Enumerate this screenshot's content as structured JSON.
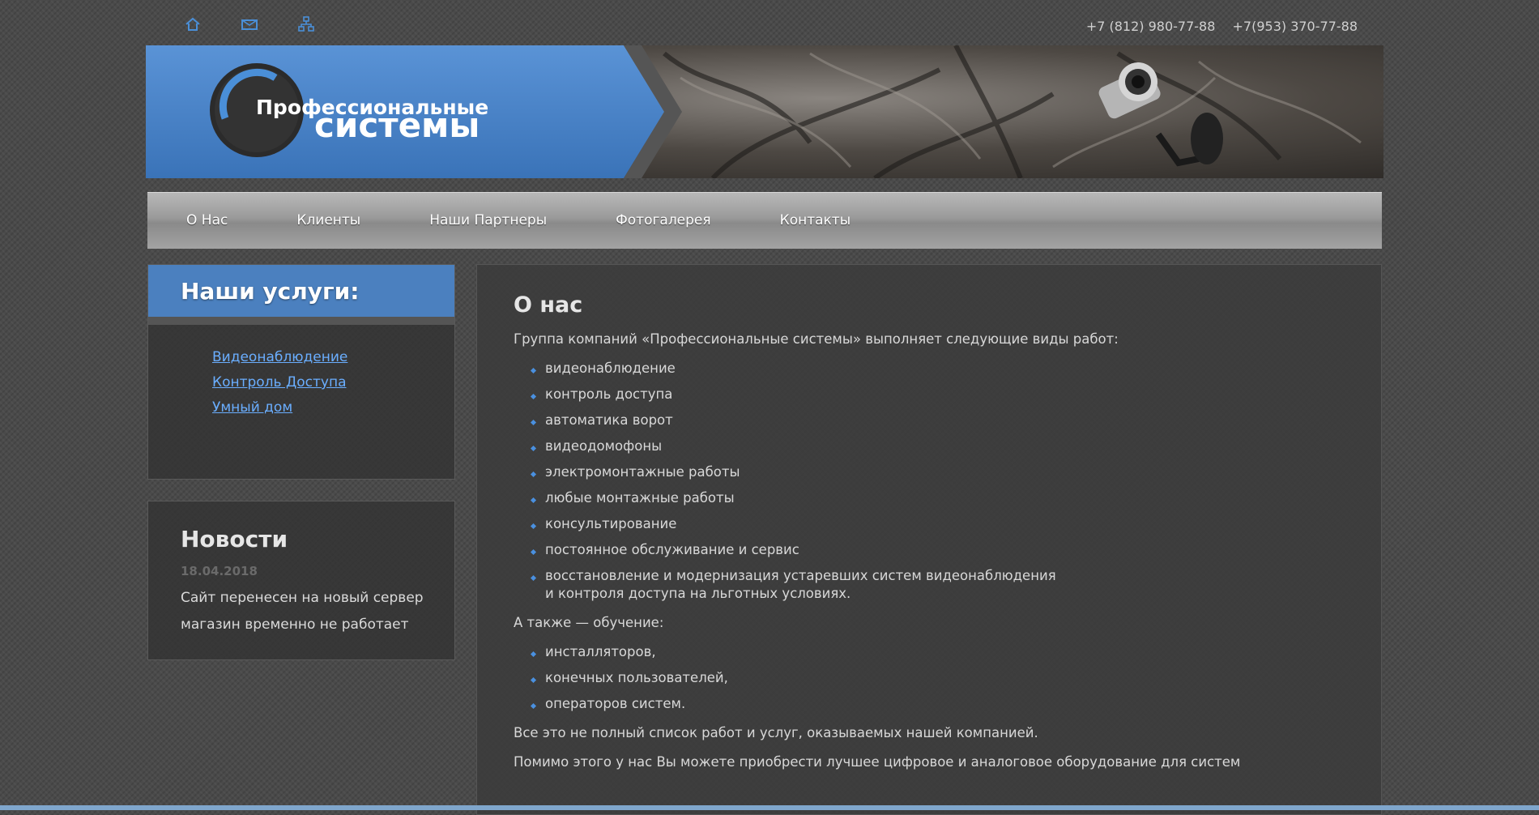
{
  "topbar": {
    "icons": [
      "home-icon",
      "mail-icon",
      "sitemap-icon"
    ],
    "phones": [
      "+7 (812) 980-77-88",
      "+7(953) 370-77-88"
    ]
  },
  "header": {
    "logo_line1": "Профессиональные",
    "logo_line2": "системы"
  },
  "nav": {
    "items": [
      "О Нас",
      "Клиенты",
      "Наши Партнеры",
      "Фотогалерея",
      "Контакты"
    ]
  },
  "services": {
    "title": "Наши услуги:",
    "links": [
      "Видеонаблюдение",
      "Контроль Доступа",
      "Умный дом"
    ]
  },
  "news": {
    "title": "Новости",
    "date": "18.04.2018",
    "text": "Сайт перенесен на новый сервер магазин временно не работает"
  },
  "content": {
    "title": "О нас",
    "intro": "Группа компаний «Профессиональные системы» выполняет следующие виды работ:",
    "works": [
      "видеонаблюдение",
      "контроль доступа",
      "автоматика ворот",
      "видеодомофоны",
      "электромонтажные работы",
      "любые монтажные работы",
      "консультирование",
      "постоянное обслуживание и сервис"
    ],
    "works_last_line1": "восстановление и модернизация устаревших систем видеонаблюдения",
    "works_last_line2": "и контроля доступа на льготных условиях.",
    "training_intro": "А также — обучение:",
    "training": [
      "инсталляторов,",
      "конечных пользователей,",
      "операторов систем."
    ],
    "outro1": "Все это не полный список работ и услуг, оказываемых нашей компанией.",
    "outro2": "Помимо этого у нас Вы можете приобрести лучшее цифровое и аналоговое оборудование для систем"
  },
  "colors": {
    "accent": "#4b80bf",
    "link": "#6aaeff",
    "background": "#4a4a4a"
  }
}
